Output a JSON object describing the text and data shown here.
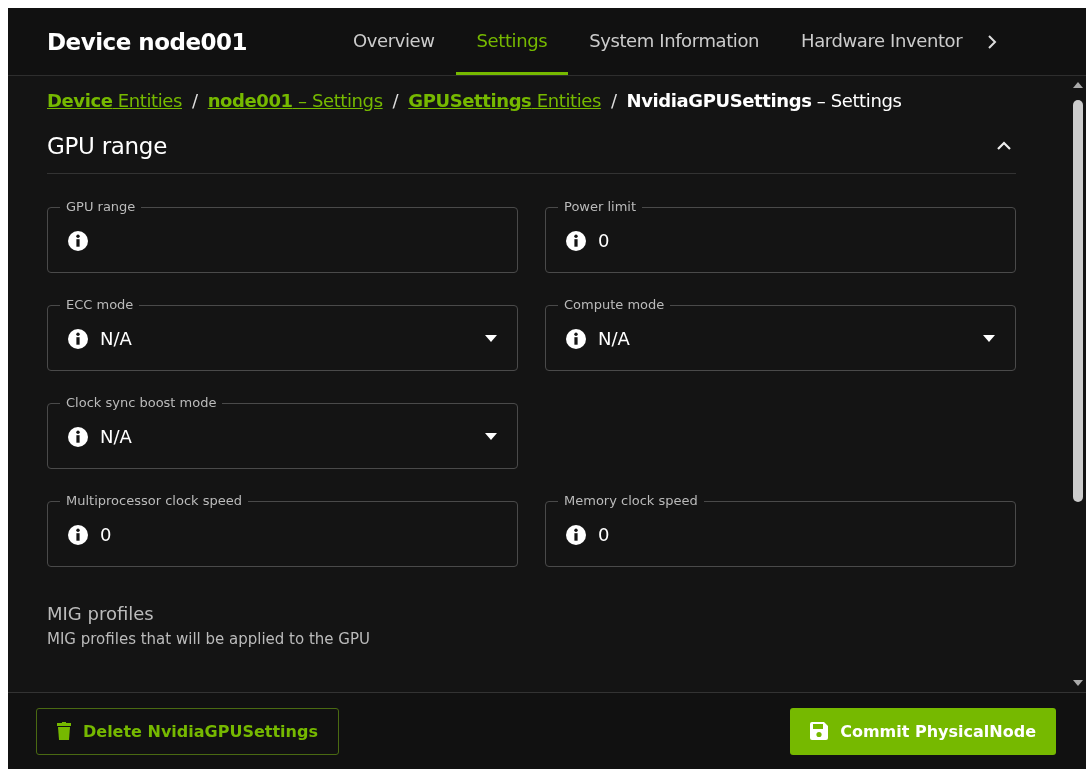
{
  "header": {
    "title": "Device node001",
    "tabs": [
      {
        "label": "Overview",
        "selected": false
      },
      {
        "label": "Settings",
        "selected": true
      },
      {
        "label": "System Information",
        "selected": false
      },
      {
        "label": "Hardware Inventor",
        "selected": false
      }
    ]
  },
  "breadcrumb": [
    {
      "text": "**Device** Entities",
      "link": true
    },
    {
      "separator": "/",
      "text": "**node001** – Settings",
      "link": true
    },
    {
      "separator": "/",
      "text": "**GPUSettings** Entities",
      "link": true
    },
    {
      "separator": "/",
      "text": "**NvidiaGPUSettings** – Settings",
      "link": false
    }
  ],
  "section": {
    "title": "GPU range",
    "expanded": true
  },
  "field_rows": [
    [
      {
        "kind": "text",
        "label": "GPU range"
      },
      {
        "kind": "text",
        "label": "Power limit",
        "value": "0"
      }
    ],
    [
      {
        "kind": "select",
        "label": "ECC mode",
        "value": "N/A"
      },
      {
        "kind": "select",
        "label": "Compute mode",
        "value": "N/A"
      }
    ],
    [
      {
        "kind": "select",
        "label": "Clock sync boost mode",
        "value": "N/A"
      }
    ],
    [
      {
        "kind": "text",
        "label": "Multiprocessor clock speed",
        "value": "0"
      },
      {
        "kind": "text",
        "label": "Memory clock speed",
        "value": "0"
      }
    ]
  ],
  "mig": {
    "title": "MIG profiles",
    "description": "MIG profiles that will be applied to the GPU"
  },
  "footer": {
    "delete_button": "Delete NvidiaGPUSettings",
    "commit_button": "Commit PhysicalNode"
  }
}
